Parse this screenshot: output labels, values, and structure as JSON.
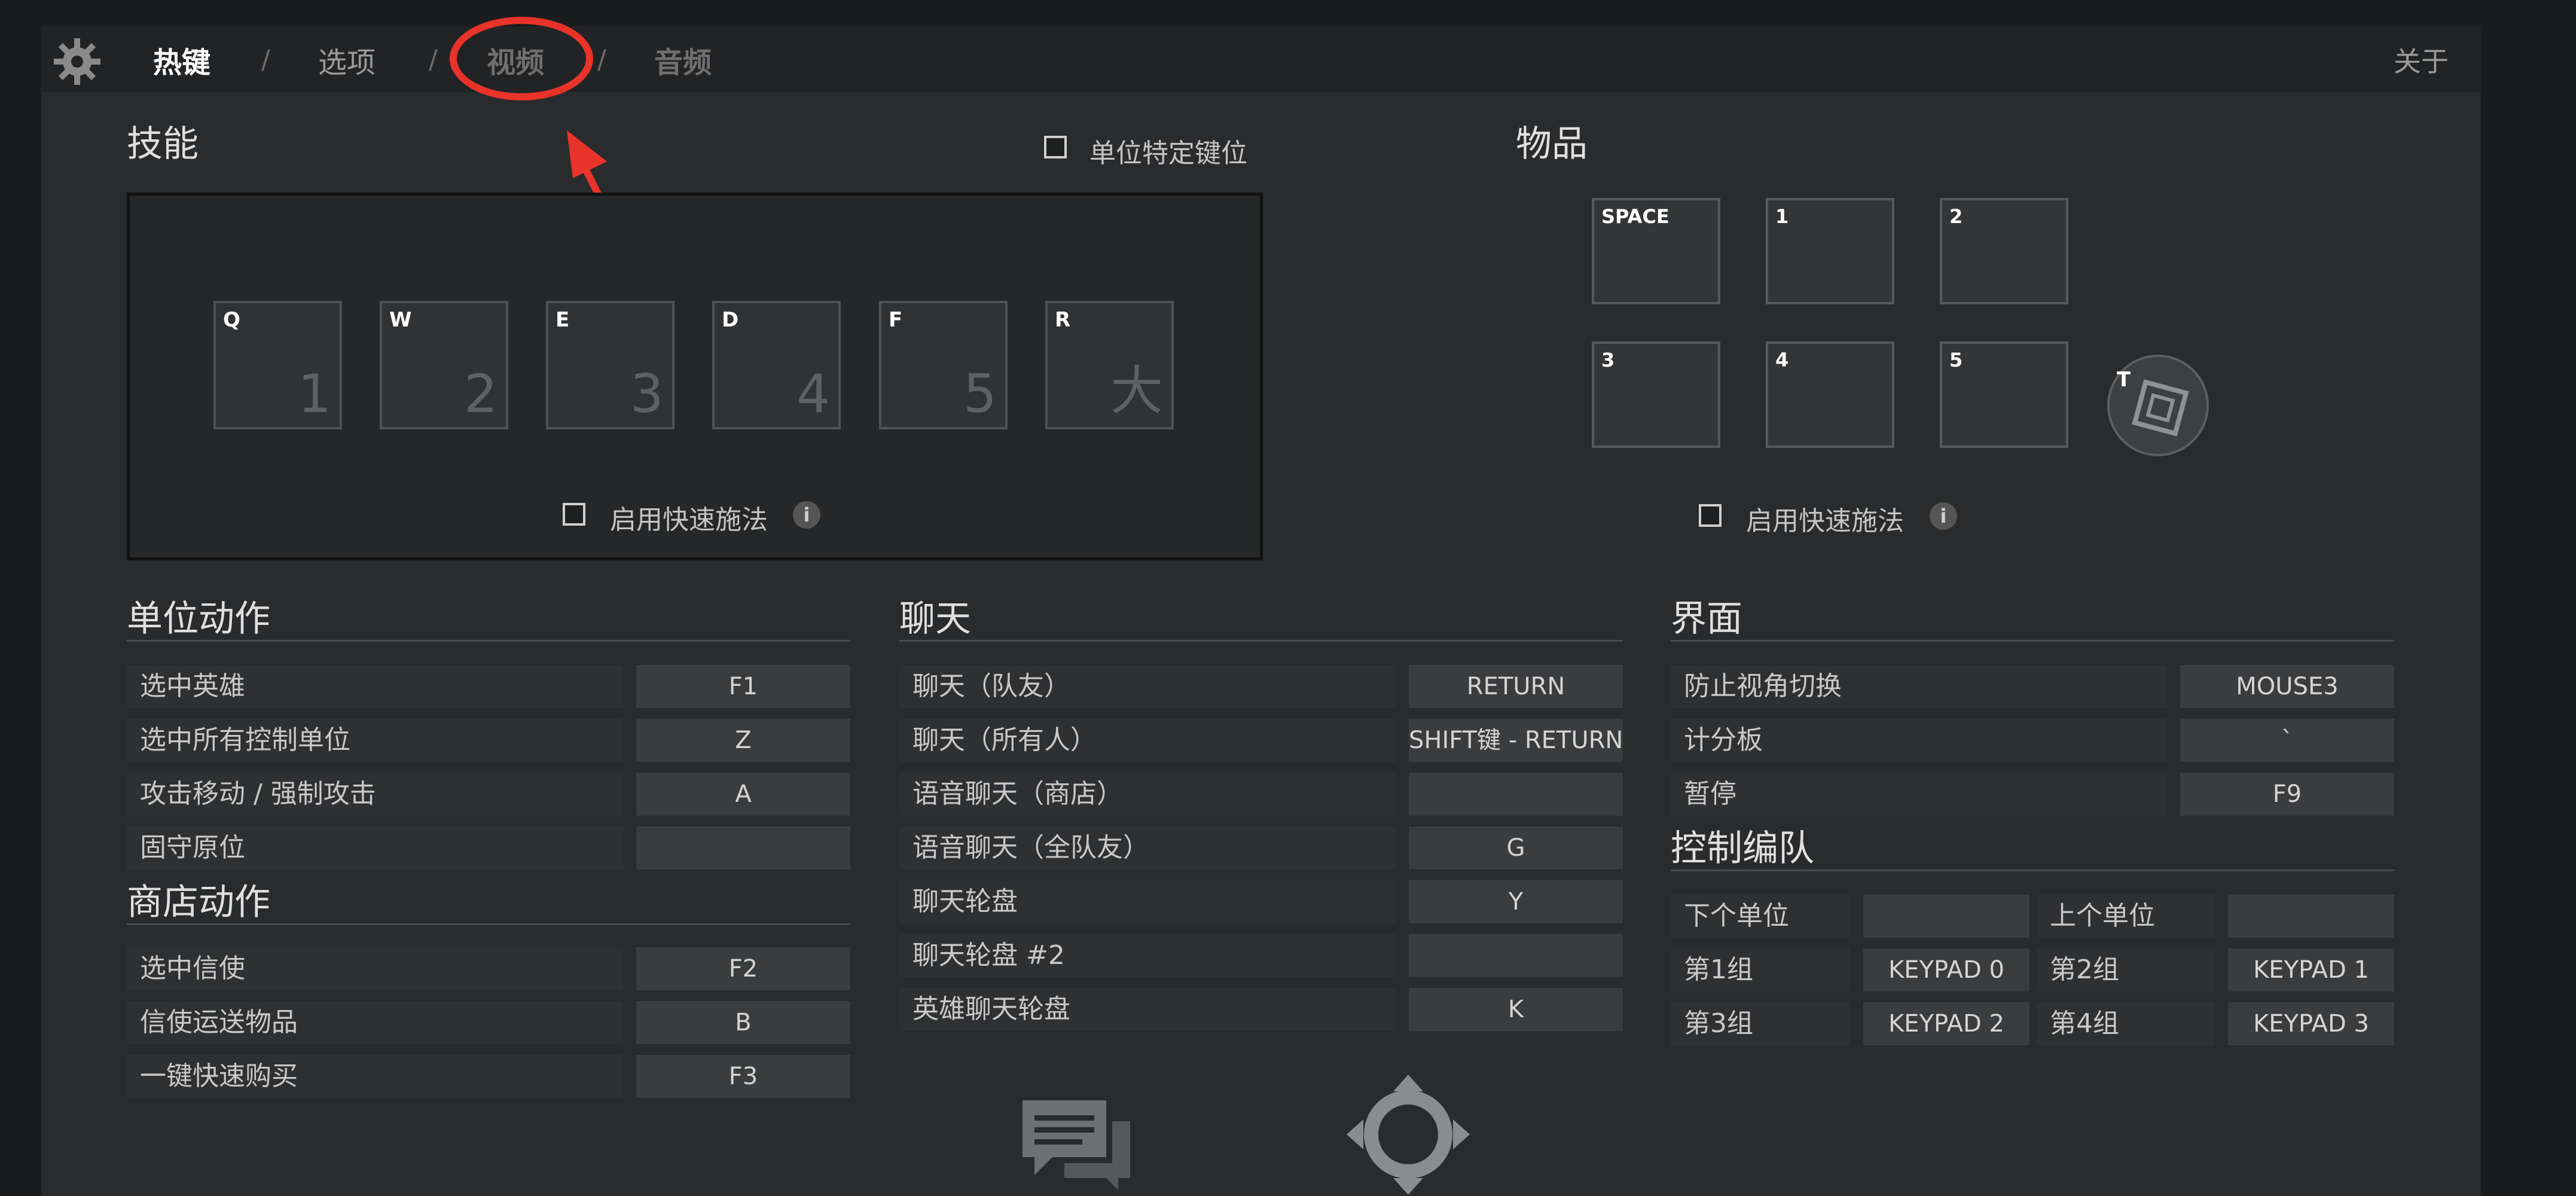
{
  "nav": {
    "tabs": [
      "热键",
      "选项",
      "视频",
      "音频"
    ],
    "separator": "/",
    "about": "关于"
  },
  "skills": {
    "title": "技能",
    "unit_specific_label": "单位特定键位",
    "slots": [
      {
        "key": "Q",
        "num": "1"
      },
      {
        "key": "W",
        "num": "2"
      },
      {
        "key": "E",
        "num": "3"
      },
      {
        "key": "D",
        "num": "4"
      },
      {
        "key": "F",
        "num": "5"
      },
      {
        "key": "R",
        "num": "大"
      }
    ],
    "quickcast_label": "启用快速施法",
    "info": "i"
  },
  "items": {
    "title": "物品",
    "slots": [
      "SPACE",
      "1",
      "2",
      "3",
      "4",
      "5"
    ],
    "neutral_key": "T",
    "quickcast_label": "启用快速施法",
    "info": "i"
  },
  "unit_actions": {
    "title": "单位动作",
    "rows": [
      {
        "label": "选中英雄",
        "key": "F1"
      },
      {
        "label": "选中所有控制单位",
        "key": "Z"
      },
      {
        "label": "攻击移动 / 强制攻击",
        "key": "A"
      },
      {
        "label": "固守原位",
        "key": ""
      }
    ]
  },
  "shop_actions": {
    "title": "商店动作",
    "rows": [
      {
        "label": "选中信使",
        "key": "F2"
      },
      {
        "label": "信使运送物品",
        "key": "B"
      },
      {
        "label": "一键快速购买",
        "key": "F3"
      }
    ]
  },
  "chat": {
    "title": "聊天",
    "rows": [
      {
        "label": "聊天（队友）",
        "key": "RETURN"
      },
      {
        "label": "聊天（所有人）",
        "key": "SHIFT键 - RETURN"
      },
      {
        "label": "语音聊天（商店）",
        "key": ""
      },
      {
        "label": "语音聊天（全队友）",
        "key": "G"
      },
      {
        "label": "聊天轮盘",
        "key": "Y"
      },
      {
        "label": "聊天轮盘 #2",
        "key": ""
      },
      {
        "label": "英雄聊天轮盘",
        "key": "K"
      }
    ]
  },
  "interface": {
    "title": "界面",
    "rows": [
      {
        "label": "防止视角切换",
        "key": "MOUSE3"
      },
      {
        "label": "计分板",
        "key": "`"
      },
      {
        "label": "暂停",
        "key": "F9"
      }
    ]
  },
  "control_groups": {
    "title": "控制编队",
    "rows": [
      [
        {
          "label": "下个单位",
          "key": ""
        },
        {
          "label": "上个单位",
          "key": ""
        }
      ],
      [
        {
          "label": "第1组",
          "key": "KEYPAD 0"
        },
        {
          "label": "第2组",
          "key": "KEYPAD 1"
        }
      ],
      [
        {
          "label": "第3组",
          "key": "KEYPAD 2"
        },
        {
          "label": "第4组",
          "key": "KEYPAD 3"
        }
      ]
    ]
  },
  "colors": {
    "annotation": "#e8332a",
    "background": "#2a2b2d"
  }
}
